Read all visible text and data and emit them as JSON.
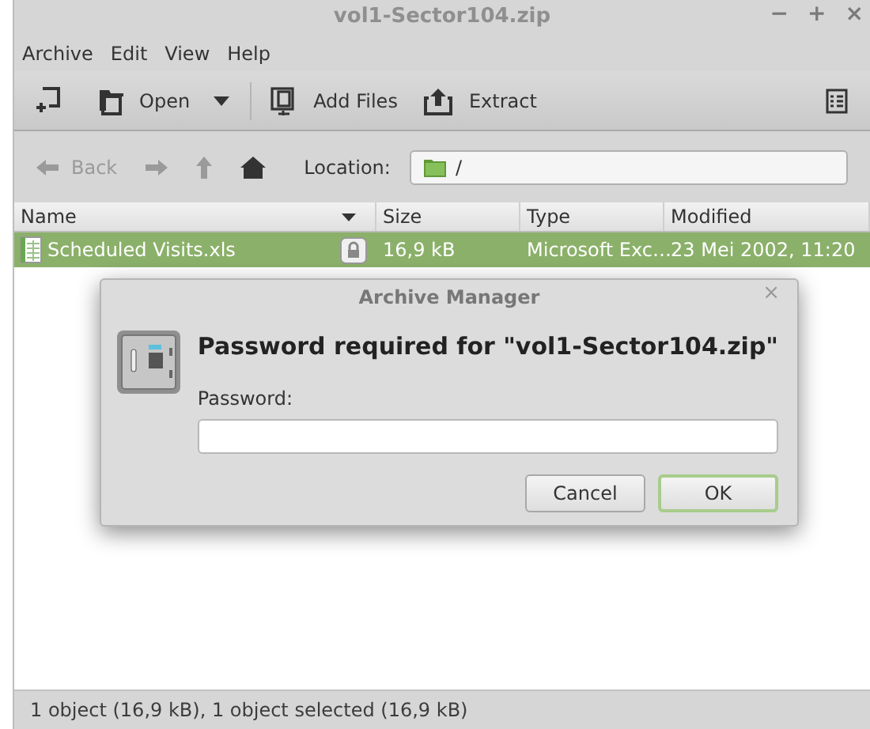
{
  "window": {
    "title": "vol1-Sector104.zip",
    "controls": [
      "−",
      "+",
      "×"
    ]
  },
  "menu": [
    {
      "label": "Archive"
    },
    {
      "label": "Edit"
    },
    {
      "label": "View"
    },
    {
      "label": "Help"
    }
  ],
  "toolbar": [
    {
      "kind": "new"
    },
    {
      "kind": "open",
      "label": "Open"
    },
    {
      "kind": "add",
      "label": "Add Files"
    },
    {
      "kind": "extract",
      "label": "Extract"
    }
  ],
  "navigation": {
    "back": {
      "label": "Back",
      "disabled": true
    },
    "forward": {
      "disabled": true
    },
    "up": {
      "disabled": true
    },
    "home": {
      "disabled": false
    },
    "location_label": "Location:",
    "location": "/"
  },
  "table": {
    "columns": [
      {
        "label": "Name",
        "sorted": true
      },
      {
        "label": "Size",
        "sorted": false
      },
      {
        "label": "Type",
        "sorted": false
      },
      {
        "label": "Modified",
        "sorted": false
      }
    ],
    "rows": [
      {
        "name": "Scheduled Visits.xls",
        "locked": true,
        "size": "16,9 kB",
        "type": "Microsoft Exc…",
        "modified": "23 Mei 2002, 11:20",
        "selected": true
      }
    ]
  },
  "dialog": {
    "title": "Archive Manager",
    "close": "×",
    "heading": "Password required for \"vol1-Sector104.zip\"",
    "field_label": "Password:",
    "buttons": [
      {
        "label": "Cancel",
        "default": false
      },
      {
        "label": "OK",
        "default": true
      }
    ]
  },
  "status_bar": "1 object (16,9 kB), 1 object selected (16,9 kB)"
}
